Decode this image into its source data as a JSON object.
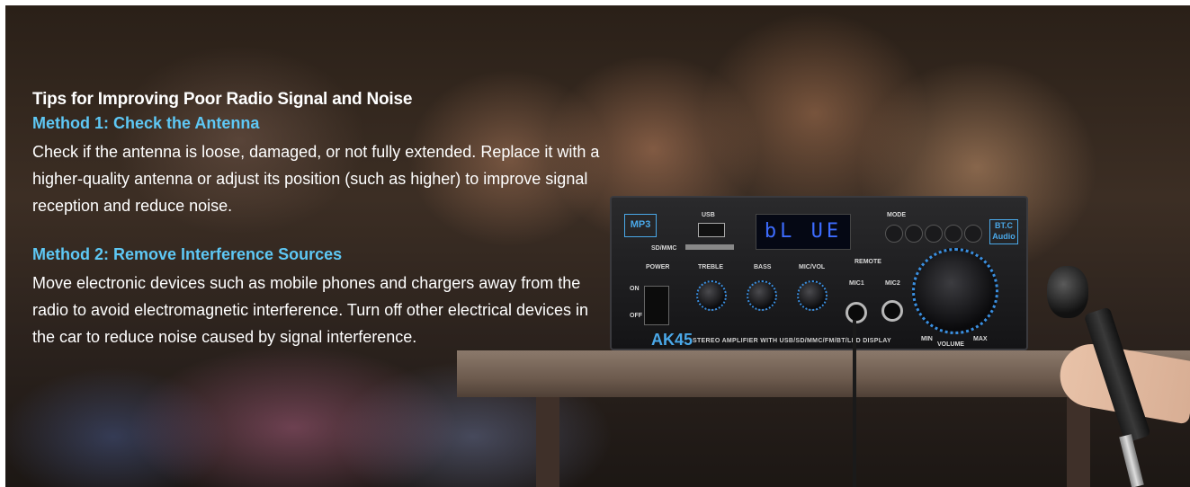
{
  "article": {
    "title": "Tips for Improving Poor Radio Signal and Noise",
    "methods": [
      {
        "heading": "Method 1: Check the Antenna",
        "body": "Check if the antenna is loose, damaged, or not fully extended. Replace it with a higher-quality antenna or adjust its position (such as higher) to improve signal reception and reduce noise."
      },
      {
        "heading": "Method 2: Remove Interference Sources",
        "body": "Move electronic devices such as mobile phones and chargers away from the radio to avoid electromagnetic interference. Turn off other electrical devices in the car to reduce noise caused by signal interference."
      }
    ]
  },
  "colors": {
    "heading_accent": "#5ec8f5",
    "text": "#ffffff",
    "amp_accent": "#4aa8e8"
  },
  "product": {
    "model": "AK45",
    "subtitle": "STEREO AMPLIFIER WITH USB/SD/MMC/FM/BT/LED DISPLAY",
    "display": "bL UE",
    "badge_left": "MP3",
    "badge_right": "BT.C Audio",
    "labels": {
      "usb": "USB",
      "sdmmc": "SD/MMC",
      "power": "POWER",
      "on": "ON",
      "off": "OFF",
      "treble": "TREBLE",
      "bass": "BASS",
      "micvol": "MIC/VOL",
      "mic1": "MIC1",
      "mic2": "MIC2",
      "mode": "MODE",
      "remote": "REMOTE",
      "volume": "VOLUME",
      "min": "MIN",
      "max": "MAX"
    }
  }
}
